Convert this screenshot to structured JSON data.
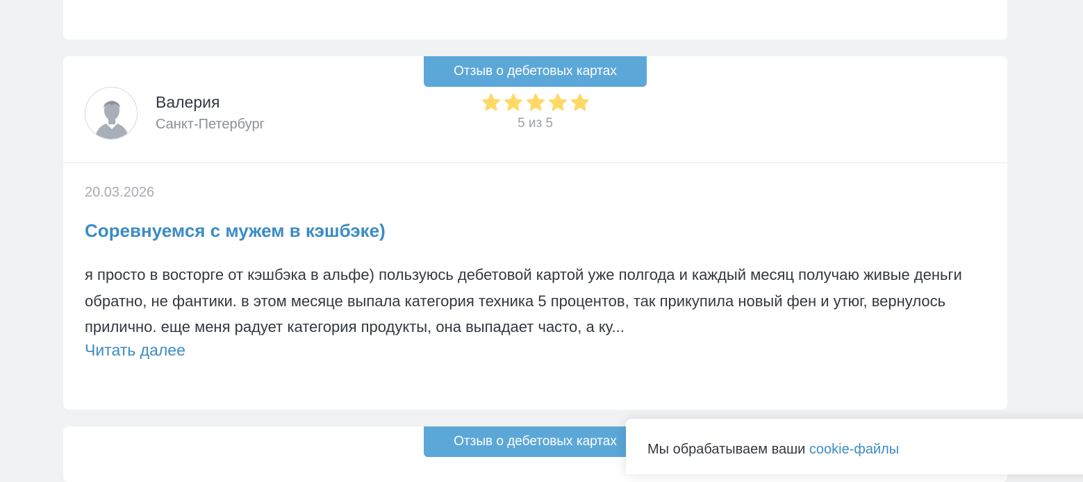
{
  "review": {
    "category": "Отзыв о дебетовых картах",
    "author": {
      "name": "Валерия",
      "city": "Санкт-Петербург",
      "avatar_icon": "user-silhouette-icon"
    },
    "rating": {
      "value": 5,
      "max": 5,
      "label": "5 из 5",
      "star_color": "#ffd966"
    },
    "date": "20.03.2026",
    "title": "Соревнуемся с мужем в кэшбэке)",
    "text": "я просто в восторге от кэшбэка в альфе) пользуюсь дебетовой картой уже полгода и каждый месяц получаю живые деньги обратно, не фантики. в этом месяце выпала категория техника 5 процентов, так прикупила новый фен и утюг, вернулось прилично. еще меня радует категория продукты, она выпадает часто, а ку...",
    "read_more": "Читать далее"
  },
  "next_review": {
    "category": "Отзыв о дебетовых картах"
  },
  "cookie": {
    "text": "Мы обрабатываем ваши ",
    "link": "cookie-файлы"
  },
  "colors": {
    "accent": "#3b8cc4",
    "badge": "#5ba7d8",
    "background": "#f0f2f4"
  }
}
